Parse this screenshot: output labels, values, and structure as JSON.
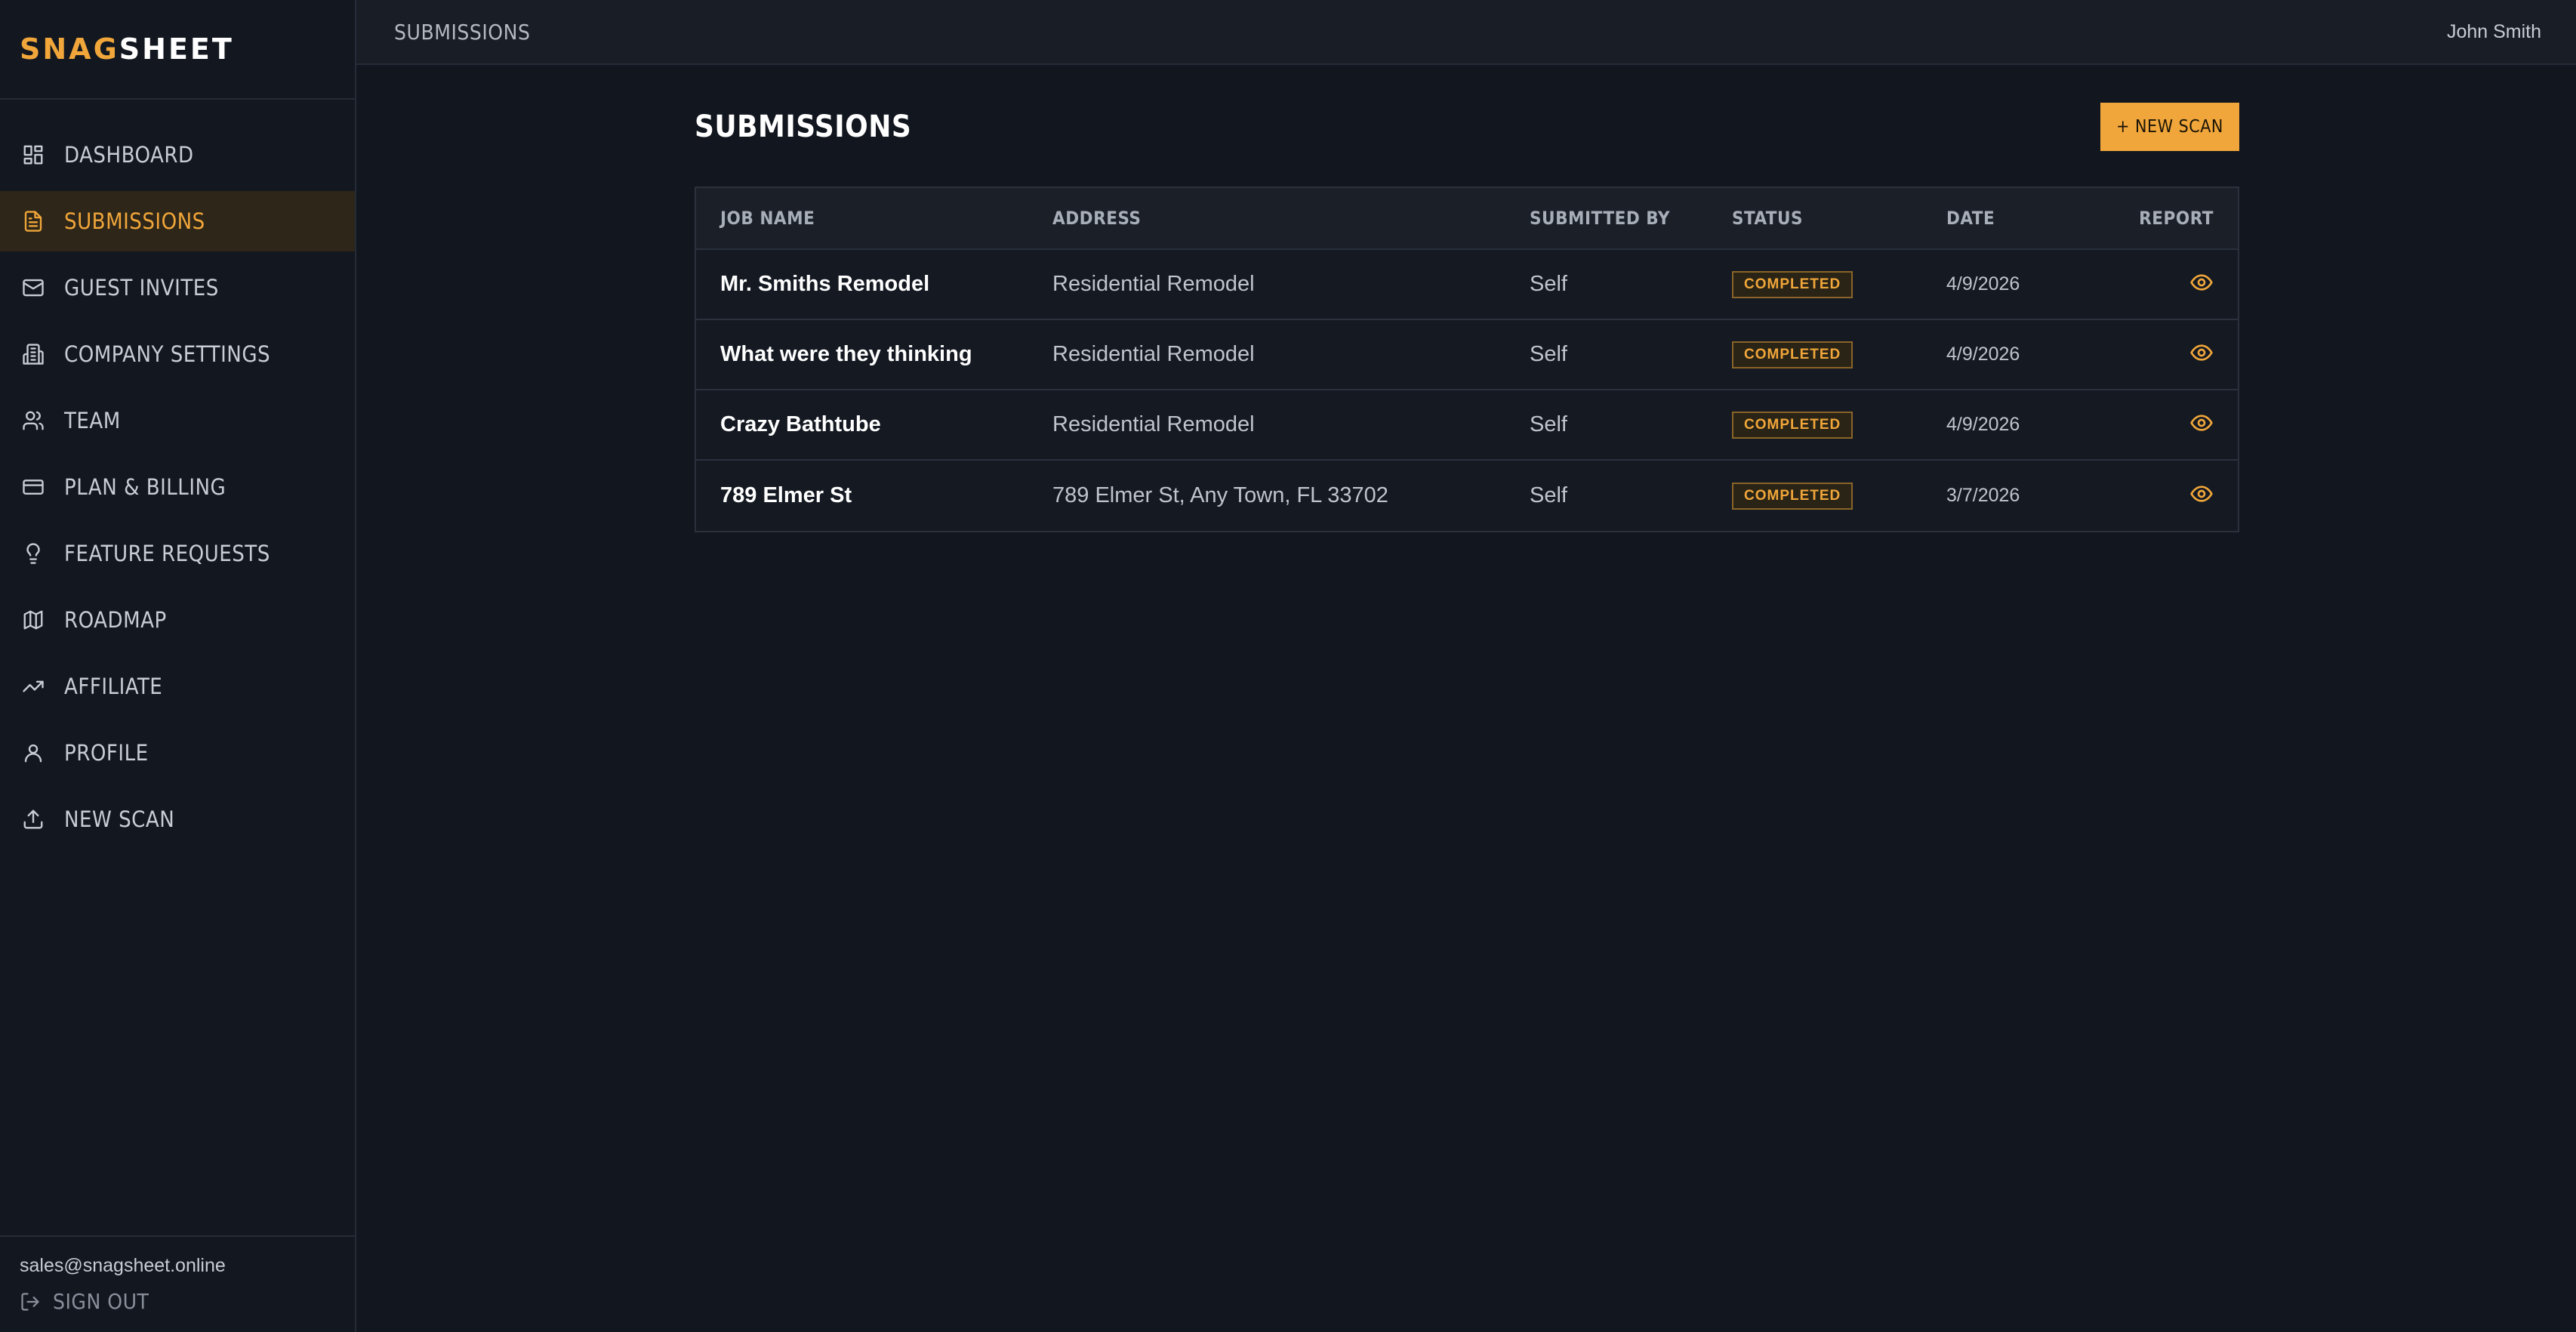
{
  "brand": {
    "part1": "SNAG",
    "part2": "SHEET",
    "accent": "#f0a63a"
  },
  "sidebar": {
    "items": [
      {
        "label": "DASHBOARD",
        "icon": "dashboard-icon"
      },
      {
        "label": "SUBMISSIONS",
        "icon": "document-icon",
        "active": true
      },
      {
        "label": "GUEST INVITES",
        "icon": "mail-icon"
      },
      {
        "label": "COMPANY SETTINGS",
        "icon": "building-icon"
      },
      {
        "label": "TEAM",
        "icon": "users-icon"
      },
      {
        "label": "PLAN & BILLING",
        "icon": "credit-card-icon"
      },
      {
        "label": "FEATURE REQUESTS",
        "icon": "lightbulb-icon"
      },
      {
        "label": "ROADMAP",
        "icon": "map-icon"
      },
      {
        "label": "AFFILIATE",
        "icon": "trending-up-icon"
      },
      {
        "label": "PROFILE",
        "icon": "user-icon"
      },
      {
        "label": "NEW SCAN",
        "icon": "upload-icon"
      }
    ],
    "email": "sales@snagsheet.online",
    "signout": "SIGN OUT"
  },
  "topbar": {
    "breadcrumb": "SUBMISSIONS",
    "user": "John Smith"
  },
  "main": {
    "title": "SUBMISSIONS",
    "new_scan_label": "+ NEW SCAN",
    "columns": [
      "JOB NAME",
      "ADDRESS",
      "SUBMITTED BY",
      "STATUS",
      "DATE",
      "REPORT"
    ],
    "rows": [
      {
        "job": "Mr. Smiths Remodel",
        "address": "Residential Remodel",
        "by": "Self",
        "status": "COMPLETED",
        "date": "4/9/2026"
      },
      {
        "job": "What were they thinking",
        "address": "Residential Remodel",
        "by": "Self",
        "status": "COMPLETED",
        "date": "4/9/2026"
      },
      {
        "job": "Crazy Bathtube",
        "address": "Residential Remodel",
        "by": "Self",
        "status": "COMPLETED",
        "date": "4/9/2026"
      },
      {
        "job": "789 Elmer St",
        "address": "789 Elmer St, Any Town, FL 33702",
        "by": "Self",
        "status": "COMPLETED",
        "date": "3/7/2026"
      }
    ]
  }
}
